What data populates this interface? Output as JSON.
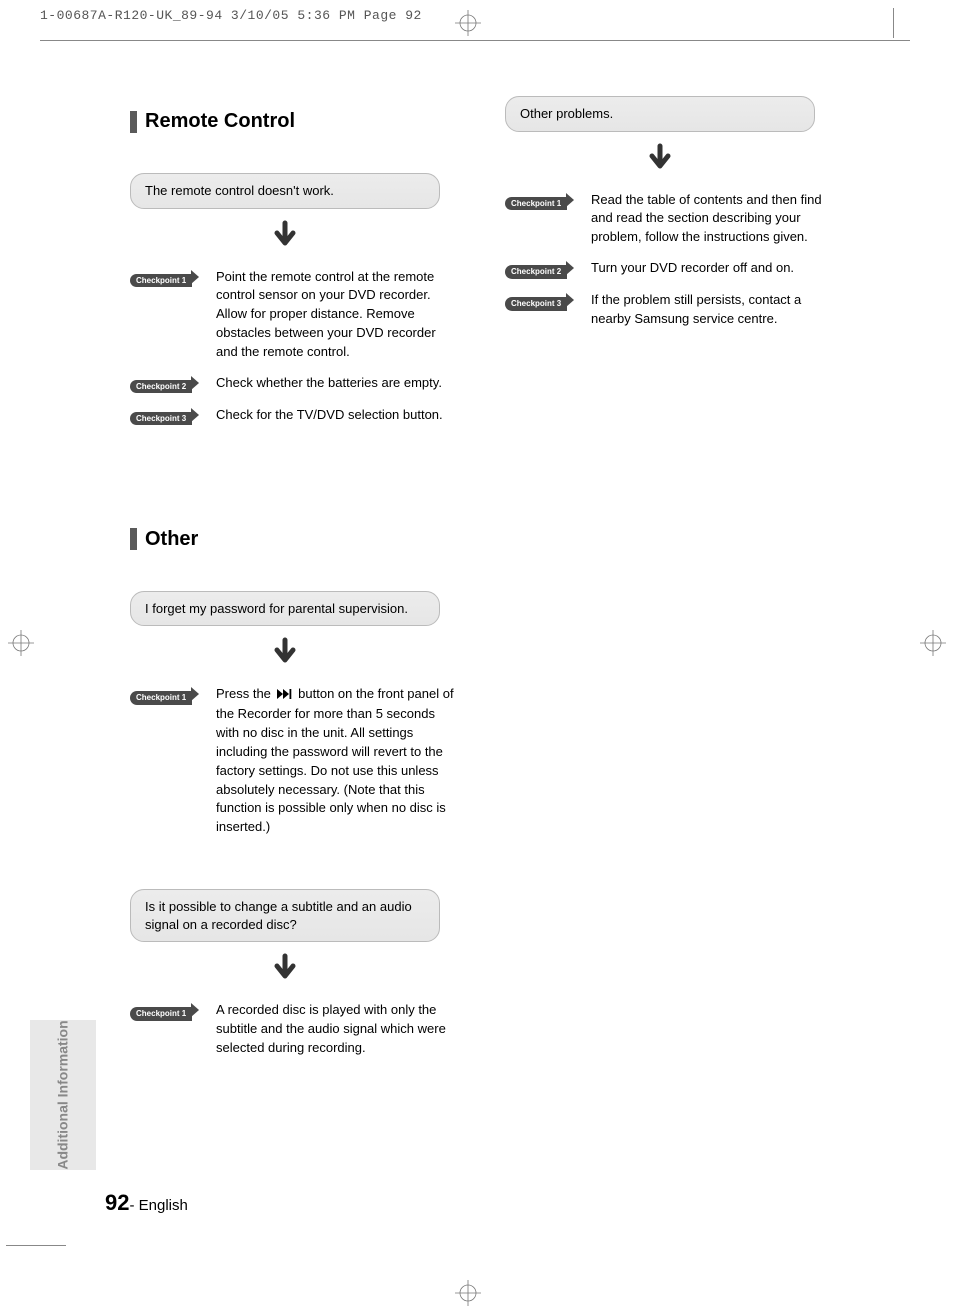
{
  "print_header": "1-00687A-R120-UK_89-94  3/10/05  5:36 PM  Page 92",
  "sections": {
    "remote": {
      "heading": "Remote Control",
      "problem": "The remote control doesn't work.",
      "checkpoints": [
        {
          "label": "Checkpoint 1",
          "text": "Point the remote control at the remote control sensor on your DVD recorder. Allow for proper distance. Remove obstacles between your DVD recorder and the remote control."
        },
        {
          "label": "Checkpoint 2",
          "text": "Check whether the batteries are empty."
        },
        {
          "label": "Checkpoint 3",
          "text": "Check for the TV/DVD selection button."
        }
      ]
    },
    "other_problems": {
      "problem": "Other problems.",
      "checkpoints": [
        {
          "label": "Checkpoint 1",
          "text": "Read the table of contents and then find and read the section describing your problem, follow the instructions given."
        },
        {
          "label": "Checkpoint 2",
          "text": "Turn your DVD recorder off and on."
        },
        {
          "label": "Checkpoint 3",
          "text": "If the problem still persists, contact a nearby Samsung service centre."
        }
      ]
    },
    "other": {
      "heading": "Other",
      "problems": [
        {
          "question": "I forget my password for parental supervision.",
          "checkpoints": [
            {
              "label": "Checkpoint 1",
              "text_before": "Press the ",
              "text_after": " button on the front panel of the Recorder for more than 5 seconds with no disc in the unit. All settings including the password will revert to the factory settings. Do not use this unless absolutely necessary. (Note that this function is possible only when no disc is inserted.)"
            }
          ]
        },
        {
          "question": "Is it possible to change a subtitle and an audio signal on a recorded disc?",
          "checkpoints": [
            {
              "label": "Checkpoint 1",
              "text": "A recorded disc is played with only the subtitle and the audio signal which were selected during recording."
            }
          ]
        }
      ]
    }
  },
  "side_tab": "Additional Information",
  "footer": {
    "page_num": "92",
    "sep": "- ",
    "lang": "English"
  }
}
